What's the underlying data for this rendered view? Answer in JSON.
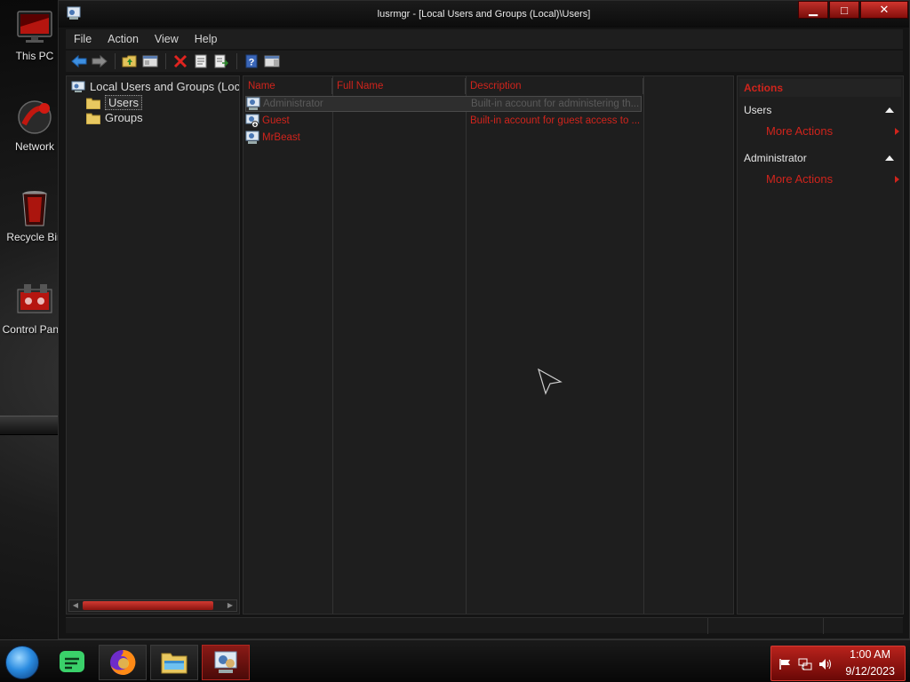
{
  "desktop": {
    "icons": [
      {
        "label": "This PC",
        "icon": "monitor-icon"
      },
      {
        "label": "Network",
        "icon": "network-icon"
      },
      {
        "label": "Recycle Bin",
        "icon": "recycle-bin-icon"
      },
      {
        "label": "Control Panel",
        "icon": "control-panel-icon"
      }
    ]
  },
  "window": {
    "title": "lusrmgr - [Local Users and Groups (Local)\\Users]",
    "caption": {
      "minimize": "▁",
      "maximize": "□",
      "close": "✕"
    },
    "menu": [
      "File",
      "Action",
      "View",
      "Help"
    ],
    "toolbar": [
      "back-icon",
      "forward-icon",
      "up-folder-icon",
      "show-hide-tree-icon",
      "delete-icon",
      "properties-icon",
      "export-list-icon",
      "help-icon",
      "show-hide-action-pane-icon"
    ]
  },
  "tree": {
    "root": "Local Users and Groups (Loc",
    "users": "Users",
    "groups": "Groups"
  },
  "list": {
    "columns": [
      "Name",
      "Full Name",
      "Description"
    ],
    "rows": [
      {
        "name": "Administrator",
        "full_name": "",
        "description": "Built-in account for administering th..."
      },
      {
        "name": "Guest",
        "full_name": "",
        "description": "Built-in account for guest access to ..."
      },
      {
        "name": "MrBeast",
        "full_name": "",
        "description": ""
      }
    ]
  },
  "actions": {
    "title": "Actions",
    "sections": [
      {
        "header": "Users",
        "link": "More Actions"
      },
      {
        "header": "Administrator",
        "link": "More Actions"
      }
    ]
  },
  "taskbar": {
    "apps": [
      "start-orb",
      "chat-app-icon",
      "firefox-icon",
      "file-explorer-icon",
      "lusrmgr-icon"
    ],
    "tray": {
      "time": "1:00 AM",
      "date": "9/12/2023"
    }
  },
  "colors": {
    "accent": "#d0241c",
    "background": "#1e1e1e"
  }
}
